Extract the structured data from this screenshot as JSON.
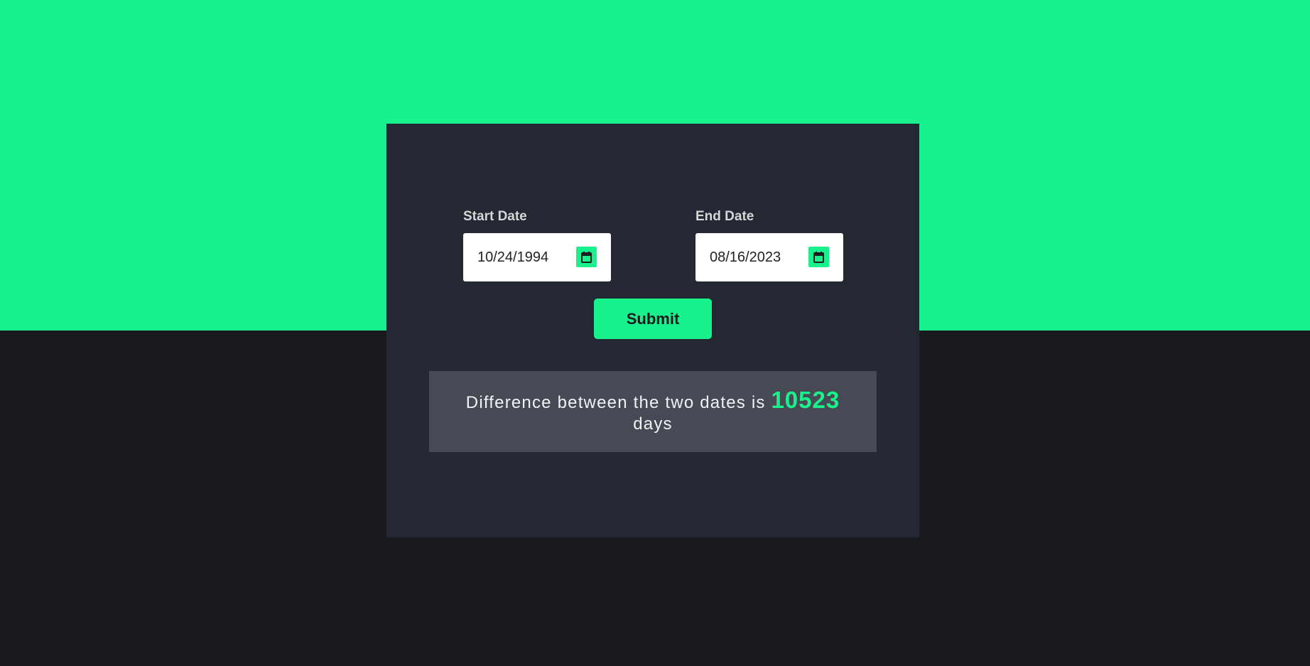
{
  "colors": {
    "accent": "#19f28c",
    "page_bottom": "#181a1f",
    "card": "#242832",
    "result_panel": "#474a54"
  },
  "form": {
    "start": {
      "label": "Start Date",
      "value": "10/24/1994",
      "icon": "calendar-icon"
    },
    "end": {
      "label": "End Date",
      "value": "08/16/2023",
      "icon": "calendar-icon"
    },
    "submit_label": "Submit"
  },
  "result": {
    "prefix": "Difference between the two dates is",
    "days": "10523",
    "suffix": "days"
  }
}
